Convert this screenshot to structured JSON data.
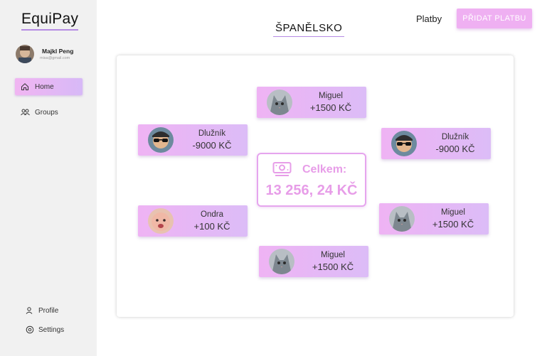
{
  "app": {
    "logo": "EquiPay"
  },
  "user": {
    "name": "Majkl Peng",
    "email": "misa@gmail.com"
  },
  "sidebar": {
    "items": [
      {
        "label": "Home",
        "icon": "home-icon",
        "active": true
      },
      {
        "label": "Groups",
        "icon": "groups-icon",
        "active": false
      }
    ],
    "bottom_items": [
      {
        "label": "Profile",
        "icon": "user-icon"
      },
      {
        "label": "Settings",
        "icon": "gear-icon"
      }
    ]
  },
  "header": {
    "nav_link": "Platby",
    "add_button": "PŘIDAT PLATBU",
    "title": "ŠPANĚLSKO"
  },
  "total": {
    "label": "Celkem:",
    "amount": "13 256, 24 KČ",
    "icon": "money-icon"
  },
  "members": [
    {
      "name": "Miguel",
      "amount": "+1500 KČ",
      "avatar": "cat"
    },
    {
      "name": "Dlužník",
      "amount": "-9000 KČ",
      "avatar": "sunglasses"
    },
    {
      "name": "Dlužník",
      "amount": "-9000 KČ",
      "avatar": "sunglasses"
    },
    {
      "name": "Ondra",
      "amount": "+100 KČ",
      "avatar": "baby"
    },
    {
      "name": "Miguel",
      "amount": "+1500 KČ",
      "avatar": "cat"
    },
    {
      "name": "Miguel",
      "amount": "+1500 KČ",
      "avatar": "cat"
    }
  ],
  "colors": {
    "accent": "#efb0f2",
    "accent_secondary": "#d7b9f7",
    "total_text": "#e79de8",
    "underline": "#b58be3",
    "sidebar_bg": "#f1f1f1"
  }
}
